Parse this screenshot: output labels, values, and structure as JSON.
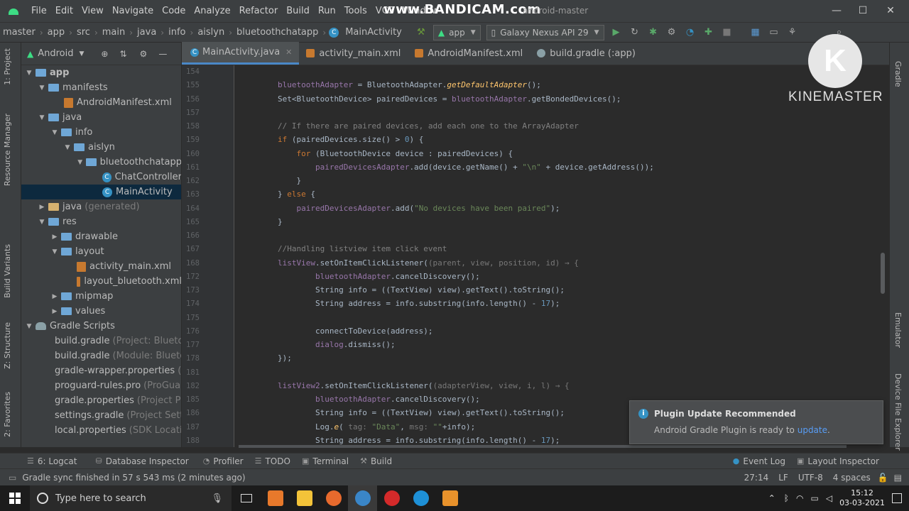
{
  "overlays": {
    "bandicam": "www.BANDICAM.com",
    "kinemaster": "KINEMASTER",
    "kinemaster_logo": "K"
  },
  "window": {
    "title": "android-master"
  },
  "menu": [
    "File",
    "Edit",
    "View",
    "Navigate",
    "Code",
    "Analyze",
    "Refactor",
    "Build",
    "Run",
    "Tools",
    "VCS",
    "Window"
  ],
  "breadcrumb": [
    "master",
    "app",
    "src",
    "main",
    "java",
    "info",
    "aislyn",
    "bluetoothchatapp",
    "MainActivity"
  ],
  "run_config": "app",
  "device": "Galaxy Nexus API 29",
  "project_panel": {
    "view": "Android",
    "tree": [
      {
        "label": "app",
        "muted": ""
      },
      {
        "label": "manifests",
        "muted": ""
      },
      {
        "label": "AndroidManifest.xml",
        "muted": ""
      },
      {
        "label": "java",
        "muted": ""
      },
      {
        "label": "info",
        "muted": ""
      },
      {
        "label": "aislyn",
        "muted": ""
      },
      {
        "label": "bluetoothchatapp",
        "muted": ""
      },
      {
        "label": "ChatController",
        "muted": ""
      },
      {
        "label": "MainActivity",
        "muted": ""
      },
      {
        "label": "java",
        "muted": "(generated)"
      },
      {
        "label": "res",
        "muted": ""
      },
      {
        "label": "drawable",
        "muted": ""
      },
      {
        "label": "layout",
        "muted": ""
      },
      {
        "label": "activity_main.xml",
        "muted": ""
      },
      {
        "label": "layout_bluetooth.xml",
        "muted": ""
      },
      {
        "label": "mipmap",
        "muted": ""
      },
      {
        "label": "values",
        "muted": ""
      },
      {
        "label": "Gradle Scripts",
        "muted": ""
      },
      {
        "label": "build.gradle",
        "muted": "(Project: Bluetoo"
      },
      {
        "label": "build.gradle",
        "muted": "(Module: Bluetoo"
      },
      {
        "label": "gradle-wrapper.properties",
        "muted": "(G"
      },
      {
        "label": "proguard-rules.pro",
        "muted": "(ProGuar"
      },
      {
        "label": "gradle.properties",
        "muted": "(Project Pro"
      },
      {
        "label": "settings.gradle",
        "muted": "(Project Settin"
      },
      {
        "label": "local.properties",
        "muted": "(SDK Location"
      }
    ]
  },
  "side_tabs_left": [
    "1: Project",
    "Resource Manager",
    "Build Variants",
    "Z: Structure",
    "2: Favorites"
  ],
  "side_tabs_right": [
    "Gradle",
    "Emulator",
    "Device File Explorer"
  ],
  "editor_tabs": [
    {
      "label": "MainActivity.java",
      "active": true
    },
    {
      "label": "activity_main.xml",
      "active": false
    },
    {
      "label": "AndroidManifest.xml",
      "active": false
    },
    {
      "label": "build.gradle (:app)",
      "active": false
    }
  ],
  "code_lines": [
    {
      "n": "154",
      "html": ""
    },
    {
      "n": "155",
      "html": "<span class='fld'>bluetoothAdapter</span> = BluetoothAdapter.<span class='it'>getDefaultAdapter</span>();"
    },
    {
      "n": "156",
      "html": "Set&lt;BluetoothDevice&gt; pairedDevices = <span class='fld'>bluetoothAdapter</span>.getBondedDevices();"
    },
    {
      "n": "157",
      "html": ""
    },
    {
      "n": "158",
      "html": "<span class='cm'>// If there are paired devices, add each one to the ArrayAdapter</span>"
    },
    {
      "n": "159",
      "html": "<span class='kw'>if</span> (pairedDevices.size() &gt; <span class='num'>0</span>) {"
    },
    {
      "n": "160",
      "html": "    <span class='kw'>for</span> (BluetoothDevice device : pairedDevices) {"
    },
    {
      "n": "161",
      "html": "        <span class='fld'>pairedDevicesAdapter</span>.add(device.getName() + <span class='str'>\"\\n\"</span> + device.getAddress());"
    },
    {
      "n": "162",
      "html": "    }"
    },
    {
      "n": "163",
      "html": "} <span class='kw'>else</span> {"
    },
    {
      "n": "164",
      "html": "    <span class='fld'>pairedDevicesAdapter</span>.add(<span class='str'>\"No devices have been paired\"</span>);"
    },
    {
      "n": "165",
      "html": "}"
    },
    {
      "n": "166",
      "html": ""
    },
    {
      "n": "167",
      "html": "<span class='cm'>//Handling listview item click event</span>"
    },
    {
      "n": "168",
      "html": "<span class='fld'>listView</span>.setOnItemClickListener(<span class='hint'>(parent, view, position, id) → {</span>"
    },
    {
      "n": "172",
      "html": "        <span class='fld'>bluetoothAdapter</span>.cancelDiscovery();"
    },
    {
      "n": "173",
      "html": "        String info = ((TextView) view).getText().toString();"
    },
    {
      "n": "174",
      "html": "        String address = info.substring(info.length() - <span class='num'>17</span>);"
    },
    {
      "n": "175",
      "html": ""
    },
    {
      "n": "176",
      "html": "        connectToDevice(address);"
    },
    {
      "n": "177",
      "html": "        <span class='fld'>dialog</span>.dismiss();"
    },
    {
      "n": "178",
      "html": "});"
    },
    {
      "n": "181",
      "html": ""
    },
    {
      "n": "182",
      "html": "<span class='fld'>listView2</span>.setOnItemClickListener(<span class='hint'>(adapterView, view, i, l) → {</span>"
    },
    {
      "n": "185",
      "html": "        <span class='fld'>bluetoothAdapter</span>.cancelDiscovery();"
    },
    {
      "n": "186",
      "html": "        String info = ((TextView) view).getText().toString();"
    },
    {
      "n": "187",
      "html": "        Log.<span class='it'>e</span>( <span class='hint'>tag:</span> <span class='str'>\"Data\"</span>, <span class='hint'>msg:</span> <span class='str'>\"\"</span>+info);"
    },
    {
      "n": "188",
      "html": "        String address = info.substring(info.length() - <span class='num'>17</span>);"
    }
  ],
  "notification": {
    "title": "Plugin Update Recommended",
    "body": "Android Gradle Plugin is ready to",
    "link": "update",
    "end": "."
  },
  "tool_windows_left": [
    "6: Logcat",
    "Database Inspector",
    "Profiler",
    "TODO",
    "Terminal",
    "Build"
  ],
  "tool_windows_right": [
    "Event Log",
    "Layout Inspector"
  ],
  "status": {
    "message": "Gradle sync finished in 57 s 543 ms (2 minutes ago)",
    "position": "27:14",
    "line_sep": "LF",
    "encoding": "UTF-8",
    "indent": "4 spaces"
  },
  "taskbar": {
    "search_placeholder": "Type here to search",
    "time": "15:12",
    "date": "03-03-2021"
  },
  "colors": {
    "accent": "#4a88c7",
    "link": "#589df6",
    "selection": "#0d293e"
  }
}
